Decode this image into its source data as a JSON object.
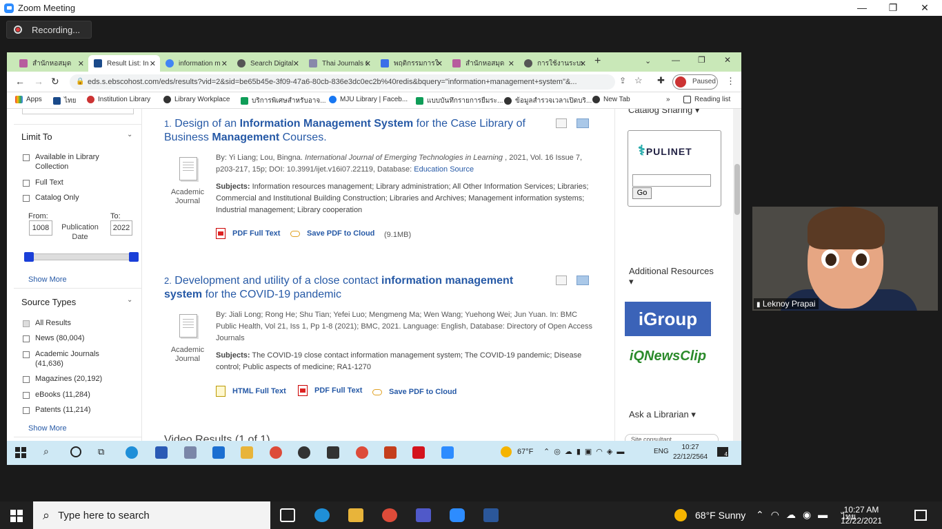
{
  "zoom": {
    "title": "Zoom Meeting",
    "recording_label": "Recording...",
    "participant_name": "Leknoy Prapai"
  },
  "browser": {
    "tabs": [
      {
        "label": "สำนักหอสมุด"
      },
      {
        "label": "Result List: In"
      },
      {
        "label": "information m"
      },
      {
        "label": "Search Digital"
      },
      {
        "label": "Thai Journals O"
      },
      {
        "label": "พฤติกรรมการใช้"
      },
      {
        "label": "สำนักหอสมุด"
      },
      {
        "label": "การใช้งานระบบ"
      }
    ],
    "url": "eds.s.ebscohost.com/eds/results?vid=2&sid=be65b45e-3f09-47a6-80cb-836e3dc0ec2b%40redis&bquery=\"information+management+system\"&...",
    "profile_status": "Paused",
    "bookmarks": [
      "Apps",
      "ไทย",
      "Institution Library",
      "Library Workplace",
      "บริการพิเศษสำหรับอาจ...",
      "MJU Library | Faceb...",
      "แบบบันทึกรายการยืมระ...",
      "ข้อมูลสำรวจเวลาเปิดบริ...",
      "New Tab"
    ],
    "reading_list": "Reading list"
  },
  "left": {
    "limit_to": "Limit To",
    "options": [
      "Available in Library Collection",
      "Full Text",
      "Catalog Only"
    ],
    "from_label": "From:",
    "to_label": "To:",
    "from_value": "1008",
    "to_value": "2022",
    "date_label": "Publication Date",
    "show_more": "Show More",
    "source_types": "Source Types",
    "sources": [
      "All Results",
      "News (80,004)",
      "Academic Journals (41,636)",
      "Magazines (20,192)",
      "eBooks (11,284)",
      "Patents (11,214)"
    ],
    "show_more_2": "Show More"
  },
  "results": [
    {
      "num": "1.",
      "title_parts": [
        "Design of an ",
        "Information Management System",
        " for the Case Library of Business ",
        "Management",
        " Courses."
      ],
      "type": "Academic Journal",
      "by": "By: Yi Liang; Lou, Bingna. ",
      "journal": "International Journal of Emerging Technologies in Learning",
      "meta_rest": " , 2021, Vol. 16 Issue 7, p203-217, 15p; DOI: 10.3991/ijet.v16i07.22119, Database: ",
      "database": "Education Source",
      "subjects_label": "Subjects:",
      "subjects": "Information resources management; Library administration; All Other Information Services; Libraries; Commercial and Institutional Building Construction; Libraries and Archives; Management information systems; Industrial management; Library cooperation",
      "pdf": "PDF Full Text",
      "cloud": "Save PDF to Cloud",
      "size": "(9.1MB)"
    },
    {
      "num": "2.",
      "title_parts": [
        "Development and utility of a close contact ",
        "information management system",
        " for the COVID-19 pandemic"
      ],
      "type": "Academic Journal",
      "by": "By: Jiali Long; Rong He; Shu Tian; Yefei Luo; Mengmeng Ma; Wen Wang; Yuehong Wei; Jun Yuan. In: BMC Public Health, Vol 21, Iss 1, Pp 1-8 (2021); BMC, 2021. Language: English, Database: Directory of Open Access Journals",
      "subjects_label": "Subjects:",
      "subjects": "The COVID-19 close contact information management system; The COVID-19 pandemic; Disease control; Public aspects of medicine; RA1-1270",
      "html": "HTML Full Text",
      "pdf": "PDF Full Text",
      "cloud": "Save PDF to Cloud"
    }
  ],
  "video_results": "Video Results (1 of 1)",
  "right": {
    "catalog_sharing": "Catalog Sharing",
    "pulinet": "PULINET",
    "go": "Go",
    "additional": "Additional Resources",
    "igroup": "iGroup",
    "iqnews": "iQNewsClip",
    "ask": "Ask a Librarian",
    "site_consultant": "Site consultant"
  },
  "inner_taskbar": {
    "weather": "67°F",
    "lang": "ENG",
    "time": "10:27",
    "date": "22/12/2564",
    "notif": "4"
  },
  "taskbar": {
    "search_placeholder": "Type here to search",
    "weather": "68°F  Sunny",
    "time": "10:27 AM",
    "date": "12/22/2021"
  },
  "colors": {
    "tabstrip": "#c9e8b8",
    "link": "#2659a6",
    "zoom_blue": "#2d8cff"
  }
}
